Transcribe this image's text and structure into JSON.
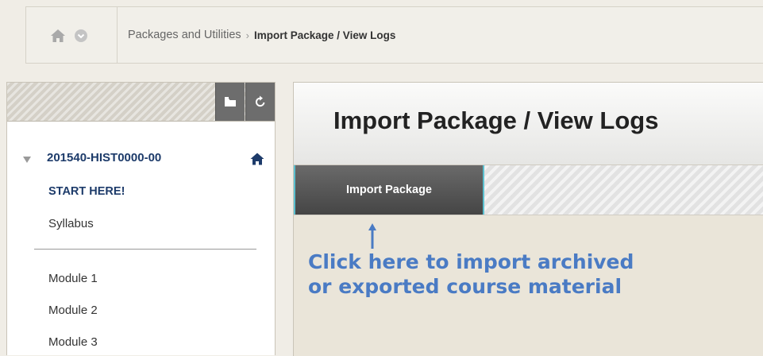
{
  "breadcrumb": {
    "parent": "Packages and Utilities",
    "separator": "›",
    "current": "Import Package / View Logs"
  },
  "course_menu": {
    "course_title": "201540-HIST0000-00",
    "items_top": [
      "START HERE!",
      "Syllabus"
    ],
    "items_modules": [
      "Module 1",
      "Module 2",
      "Module 3"
    ],
    "toolbar_icons": [
      "folder-icon",
      "refresh-icon"
    ]
  },
  "content": {
    "page_title": "Import Package / View Logs",
    "import_button_label": "Import Package",
    "callout_line1": "Click here to import archived",
    "callout_line2": "or exported course material"
  },
  "colors": {
    "callout": "#4a7bc4",
    "course_title": "#1d3b6a",
    "button_accent": "#5bc0cf"
  }
}
